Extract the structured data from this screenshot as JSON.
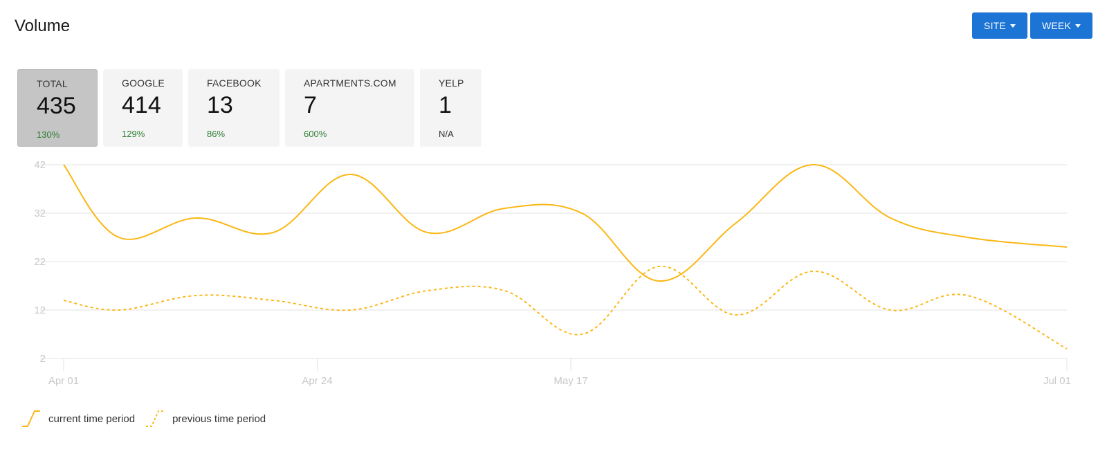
{
  "header": {
    "title": "Volume",
    "site_button": "SITE",
    "week_button": "WEEK"
  },
  "stats": [
    {
      "label": "TOTAL",
      "value": "435",
      "change": "130%",
      "active": true,
      "na": false
    },
    {
      "label": "GOOGLE",
      "value": "414",
      "change": "129%",
      "active": false,
      "na": false
    },
    {
      "label": "FACEBOOK",
      "value": "13",
      "change": "86%",
      "active": false,
      "na": false
    },
    {
      "label": "APARTMENTS.COM",
      "value": "7",
      "change": "600%",
      "active": false,
      "na": false
    },
    {
      "label": "YELP",
      "value": "1",
      "change": "N/A",
      "active": false,
      "na": true
    }
  ],
  "chart_data": {
    "type": "line",
    "title": "",
    "xlabel": "",
    "ylabel": "",
    "x_ticks": [
      "Apr 01",
      "Apr 24",
      "May 17",
      "Jul 01"
    ],
    "x_tick_days": [
      0,
      23,
      46,
      91
    ],
    "y_ticks": [
      42,
      32,
      22,
      12,
      2
    ],
    "ylim": [
      2,
      42
    ],
    "grid": true,
    "legend_position": "bottom-left",
    "color": "#fbb714",
    "series": [
      {
        "name": "current time period",
        "style": "solid",
        "x_days": [
          0,
          5,
          12,
          19,
          26,
          33,
          40,
          47,
          54,
          61,
          68,
          75,
          82,
          91
        ],
        "values": [
          42,
          27,
          31,
          28,
          40,
          28,
          33,
          32,
          18,
          30,
          42,
          31,
          27,
          25
        ]
      },
      {
        "name": "previous time period",
        "style": "dashed",
        "x_days": [
          0,
          5,
          12,
          19,
          26,
          33,
          40,
          47,
          54,
          61,
          68,
          75,
          82,
          91
        ],
        "values": [
          14,
          12,
          15,
          14,
          12,
          16,
          16,
          7,
          21,
          11,
          20,
          12,
          15,
          4
        ]
      }
    ]
  }
}
